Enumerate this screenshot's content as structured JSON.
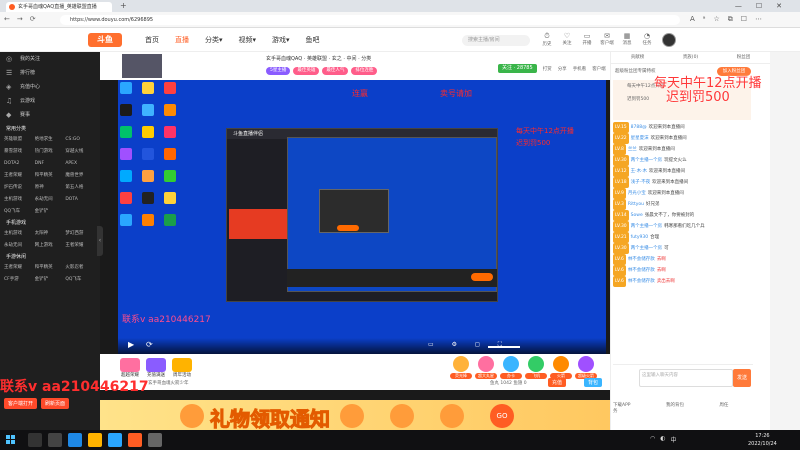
{
  "browser": {
    "tab_title": "玄手哥血魂QAQ直播_英雄联盟直播",
    "url": "https://www.douyu.com/6296895",
    "nav_glyphs": "←→⟳",
    "tools_glyphs": "Aᵃ☆⧉☐⋯",
    "window_glyphs": "—☐✕"
  },
  "header": {
    "logo": "斗鱼",
    "nav": [
      "首页",
      "直播",
      "分类▾",
      "视频▾",
      "游戏▾",
      "鱼吧"
    ],
    "search_placeholder": "搜索主播/房间",
    "icons": [
      {
        "glyph": "⏱",
        "label": "历史"
      },
      {
        "glyph": "♡",
        "label": "关注"
      },
      {
        "glyph": "▭",
        "label": "开播"
      },
      {
        "glyph": "✉",
        "label": "客户端"
      },
      {
        "glyph": "▦",
        "label": "消息"
      },
      {
        "glyph": "◔",
        "label": "任务"
      }
    ]
  },
  "sidebar": {
    "top_items": [
      {
        "icon": "◎",
        "label": "我的关注"
      },
      {
        "icon": "☰",
        "label": "排行榜"
      },
      {
        "icon": "◈",
        "label": "充值中心"
      },
      {
        "icon": "♫",
        "label": "云游戏"
      },
      {
        "icon": "◆",
        "label": "赛事"
      }
    ],
    "section1": "常用分类",
    "grid1": [
      "英雄联盟",
      "绝地求生",
      "CS:GO",
      "暴雪游戏",
      "热门游戏",
      "穿越火线",
      "DOTA2",
      "DNF",
      "APEX",
      "王者荣耀",
      "和平精英",
      "魔兽世界",
      "炉石传说",
      "原神",
      "第五人格",
      "主机游戏",
      "永劫无间",
      "DOTA",
      "QQ飞车",
      "金铲铲"
    ],
    "section2": "手机游戏",
    "grid2": [
      "主机游戏",
      "太阳神",
      "梦幻西游",
      "永劫无间",
      "网上游戏",
      "王者荣耀"
    ],
    "section3": "手游休闲",
    "grid3": [
      "王者荣耀",
      "和平精英",
      "火影忍者",
      "CF手游",
      "金铲铲",
      "QQ飞车"
    ]
  },
  "room": {
    "title": "玄手哥血魂QAQ · 英雄联盟 · 玄之 · 中间 · 分类",
    "tags": [
      "5星主播",
      "最佳英雄",
      "最佳人气",
      "排位连胜"
    ],
    "follow": "关注 · 28785",
    "reward": "打赏",
    "actions": [
      "分享",
      "手机看",
      "客户端"
    ]
  },
  "player": {
    "red_text_1": "连赢",
    "red_text_2": "卖号请加",
    "red_text_3": "每天中午12点开播",
    "red_text_4": "迟到罚500",
    "watermark": "联系v  aa210446217",
    "inner_title": "斗鱼直播伴侣"
  },
  "gift_bar": {
    "left_chips": [
      "超越荣耀",
      "充值满送",
      "周年活动"
    ],
    "online": "在线 1.2万",
    "subline": "玄手哥血魂火箭少年",
    "coins": "鱼丸 1042  鱼翅 0",
    "recharge": "充值",
    "backpack": "背包",
    "gifts": [
      "荧光棒",
      "超大丸星",
      "办卡",
      "飞机",
      "火箭",
      "超级火箭"
    ]
  },
  "banner": {
    "text": "礼物领取通知",
    "go": "GO"
  },
  "chat": {
    "tabs": [
      "贡献榜",
      "贵族(0)",
      "粉丝团"
    ],
    "fans_text": "超级粉丝团专属特权",
    "fans_btn": "加入粉丝团",
    "announce": [
      "每天中午12点开播",
      "迟到罚500"
    ],
    "red_overlay_1": "每天中午12点开播",
    "red_overlay_2": "迟到罚500",
    "messages": [
      {
        "lv": "LV.15",
        "user": "8788@",
        "text": "欢迎来到本直播间"
      },
      {
        "lv": "LV.22",
        "user": "星星夏沫",
        "text": "欢迎来到本直播间"
      },
      {
        "lv": "LV.8",
        "user": "兰兰",
        "text": "欢迎来到本直播间"
      },
      {
        "lv": "LV.30",
        "user": "两个主播一个房",
        "text": "玩提文火么"
      },
      {
        "lv": "LV.12",
        "user": "王·木·木",
        "text": "欢迎来到本直播间"
      },
      {
        "lv": "LV.18",
        "user": "浅子·不夜",
        "text": "欢迎来到本直播间"
      },
      {
        "lv": "LV.9",
        "user": "月光小宝",
        "text": "欢迎来到本直播间"
      },
      {
        "lv": "LV.3",
        "user": "Rittyou",
        "text": "好兄弟"
      },
      {
        "lv": "LV.14",
        "user": "Sowe",
        "text": "张晨文不了，你要被封的"
      },
      {
        "lv": "LV.30",
        "user": "两个主播一个房",
        "text": "韩寒那看们吃几个兵"
      },
      {
        "lv": "LV.21",
        "user": "futy930",
        "text": "合理"
      },
      {
        "lv": "LV.30",
        "user": "两个主播一个房",
        "text": "可"
      },
      {
        "lv": "LV.6",
        "user": "林不会储存款",
        "text": "去啊"
      },
      {
        "lv": "LV.6",
        "user": "林不会储存款",
        "text": "去啊"
      },
      {
        "lv": "LV.6",
        "user": "林不会储存款",
        "text": "卖出去啊"
      }
    ],
    "input_placeholder": "这里输入聊天内容",
    "send": "发送",
    "footer": [
      "下载APP",
      "我的背包",
      "周任务"
    ]
  },
  "left_ad": {
    "text": "联系v  aa210446217",
    "btn1": "客户端打开",
    "btn2": "刷新页面"
  },
  "taskbar": {
    "time": "17:26",
    "date": "2022/10/24"
  }
}
